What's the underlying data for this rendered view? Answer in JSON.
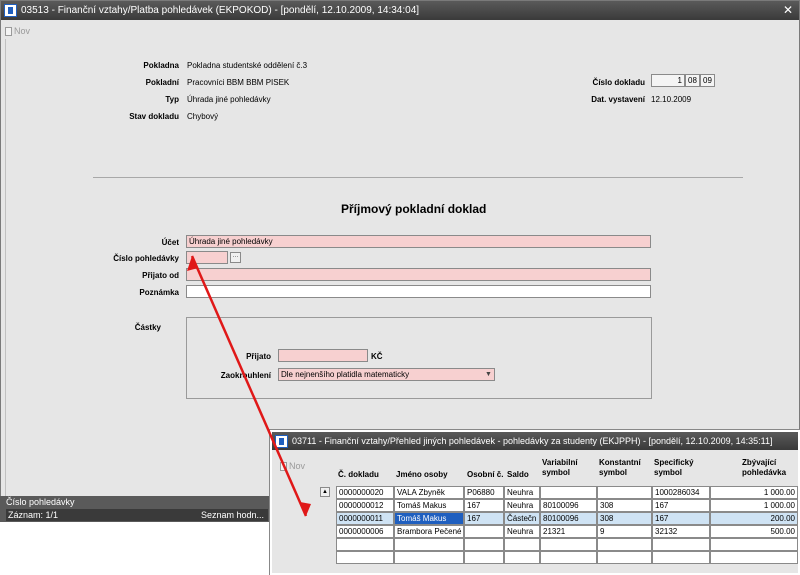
{
  "main_window": {
    "title": "03513 - Finanční vztahy/Platba pohledávek (EKPOKOD) - [pondělí, 12.10.2009, 14:34:04]",
    "toolbar": {
      "new_label": "Nov"
    },
    "header": {
      "pokladna_label": "Pokladna",
      "pokladna_value": "Pokladna studentské oddělení č.3",
      "pokladni_label": "Pokladní",
      "pokladni_value": "Pracovníci BBM BBM PISEK",
      "typ_label": "Typ",
      "typ_value": "Úhrada jiné pohledávky",
      "stav_label": "Stav dokladu",
      "stav_value": "Chybový",
      "cislo_dokladu_label": "Číslo dokladu",
      "cislo_dokladu_parts": [
        "1",
        "08",
        "09"
      ],
      "datum_label": "Dat. vystavení",
      "datum_value": "12.10.2009"
    },
    "form": {
      "heading": "Příjmový pokladní doklad",
      "ucet_label": "Účet",
      "ucet_value": "Úhrada jiné pohledávky",
      "cislo_pohledavky_label": "Číslo pohledávky",
      "cislo_pohledavky_value": "",
      "prijato_od_label": "Přijato od",
      "prijato_od_value": "",
      "poznamka_label": "Poznámka",
      "poznamka_value": ""
    },
    "amounts": {
      "section_label": "Částky",
      "prijato_label": "Přijato",
      "prijato_value": "",
      "currency": "KČ",
      "zaokrouhleni_label": "Zaokrouhlení",
      "zaokrouhleni_value": "Dle nejnenšího platidla matematicky"
    },
    "left_panel": {
      "title": "Číslo pohledávky",
      "record_label": "Záznam: 1/1",
      "list_label": "Seznam hodn..."
    }
  },
  "secondary_window": {
    "title": "03711 - Finanční vztahy/Přehled jiných pohledávek - pohledávky za studenty (EKJPPH) - [pondělí, 12.10.2009, 14:35:11]",
    "toolbar": {
      "new_label": "Nov"
    },
    "columns": [
      "Č. dokladu",
      "Jméno osoby",
      "Osobní č.",
      "Saldo",
      "Variabilní symbol",
      "Konstantní symbol",
      "Specifický symbol",
      "Zbývající pohledávka"
    ],
    "rows": [
      [
        "0000000020",
        "VALA Zbyněk",
        "P06880",
        "Neuhra",
        "",
        "",
        "1000286034",
        "1 000.00"
      ],
      [
        "0000000012",
        "Tomáš Makus",
        "167",
        "Neuhra",
        "80100096",
        "308",
        "167",
        "1 000.00"
      ],
      [
        "0000000011",
        "Tomáš Makus",
        "167",
        "Částečn",
        "80100096",
        "308",
        "167",
        "200.00"
      ],
      [
        "0000000006",
        "Brambora Pečené",
        "",
        "Neuhra",
        "21321",
        "9",
        "32132",
        "500.00"
      ],
      [
        "",
        "",
        "",
        "",
        "",
        "",
        "",
        ""
      ]
    ],
    "selected_row": 2
  },
  "colors": {
    "title_bar": "#3a3a3a",
    "window_bg": "#e6e6e6",
    "required_field": "#f7d0d0",
    "selection": "#1f5fbf",
    "arrow": "#e01818"
  }
}
